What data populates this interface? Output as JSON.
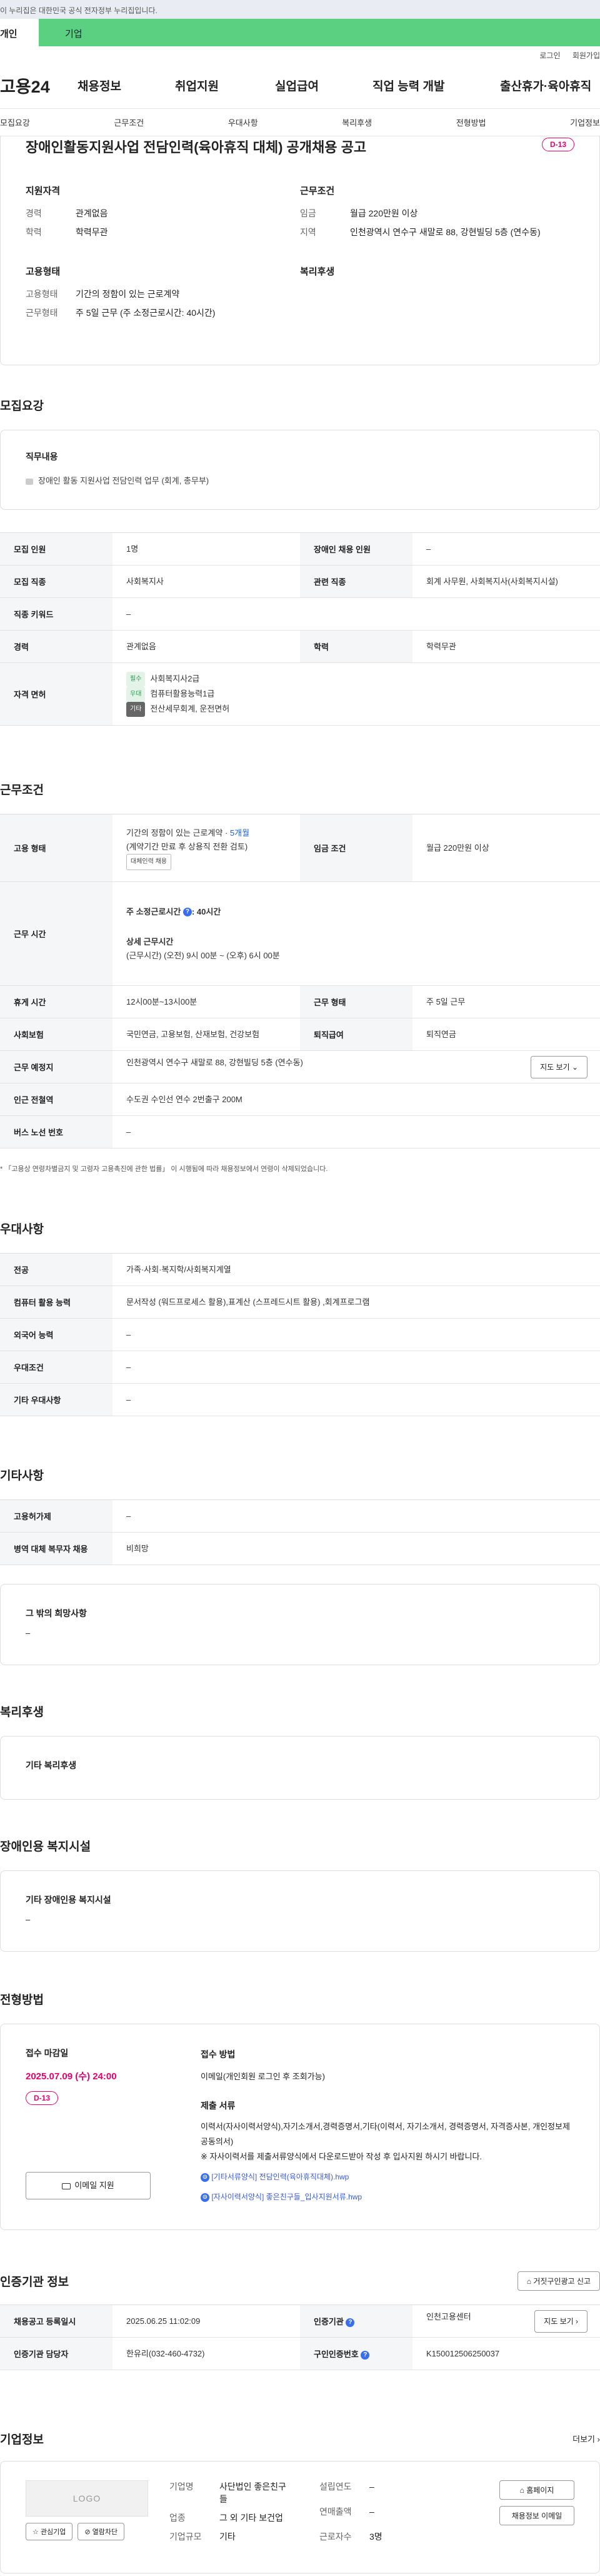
{
  "gov_strip": "이 누리집은 대한민국 공식 전자정부 누리집입니다.",
  "member_tabs": [
    "개인",
    "기업"
  ],
  "util_links": [
    "로그인",
    "회원가입"
  ],
  "logo": "고용24",
  "gnb_menu": [
    "채용정보",
    "취업지원",
    "실업급여",
    "직업 능력 개발",
    "출산휴가·육아휴직"
  ],
  "subnav": [
    "모집요강",
    "근무조건",
    "우대사항",
    "복리후생",
    "전형방법",
    "기업정보"
  ],
  "job": {
    "title": "장애인활동지원사업 전담인력(육아휴직 대체) 공개채용 공고",
    "dday": "D-13",
    "qual_h": "지원자격",
    "cond_h": "근무조건",
    "emp_h": "고용형태",
    "welfare_h": "복리후생",
    "career_k": "경력",
    "career_v": "관계없음",
    "edu_k": "학력",
    "edu_v": "학력무관",
    "wage_k": "임금",
    "wage_v": "월급 220만원 이상",
    "region_k": "지역",
    "region_v": "인천광역시 연수구 새말로 88, 강현빌딩 5층 (연수동)",
    "emptype_k": "고용형태",
    "emptype_v": "기간의 정함이 있는 근로계약",
    "worktype_k": "근무형태",
    "worktype_v": "주 5일 근무 (주 소정근로시간: 40시간)"
  },
  "recruit": {
    "title": "모집요강",
    "duty_h": "직무내용",
    "duty_v": "장애인 활동 지원사업 전담인력 업무 (회계, 총무부)",
    "rows": {
      "count_k": "모집 인원",
      "count_v": "1명",
      "disab_k": "장애인 채용 인원",
      "disab_v": "–",
      "job_k": "모집 직종",
      "job_v": "사회복지사",
      "rel_k": "관련 직종",
      "rel_v": "회계 사무원, 사회복지사(사회복지시설)",
      "kw_k": "직종 키워드",
      "kw_v": "–",
      "career_k": "경력",
      "career_v": "관계없음",
      "edu_k": "학력",
      "edu_v": "학력무관",
      "lic_k": "자격 면허",
      "lic_tags": [
        "필수",
        "우대",
        "기타"
      ],
      "lic_vals": [
        "사회복지사2급",
        "컴퓨터활용능력1급",
        "전산세무회계, 운전면허"
      ]
    }
  },
  "cond": {
    "title": "근무조건",
    "emp_k": "고용 형태",
    "emp_v1": "기간의 정함이 있는 근로계약 · ",
    "emp_v1b": "5개월",
    "emp_v2": "(계약기간 만료 후 상용직 전환 검토)",
    "emp_tag": "대체인력 채용",
    "wage_k": "임금 조건",
    "wage_v": "월급 220만원 이상",
    "time_k": "근무 시간",
    "time_v1": "주 소정근로시간",
    "time_v1b": ": 40시간",
    "time_v2": "상세 근무시간",
    "time_v3": "(근무시간) (오전) 9시 00분 ~ (오후) 6시 00분",
    "rest_k": "휴게 시간",
    "rest_v": "12시00분~13시00분",
    "form_k": "근무 형태",
    "form_v": "주 5일 근무",
    "ins_k": "사회보험",
    "ins_v": "국민연금, 고용보험, 산재보험, 건강보험",
    "sev_k": "퇴직급여",
    "sev_v": "퇴직연금",
    "place_k": "근무 예정지",
    "place_v": "인천광역시 연수구 새말로 88, 강현빌딩 5층 (연수동)",
    "map_btn": "지도 보기",
    "subway_k": "인근 전철역",
    "subway_v": "수도권 수인선 연수 2번출구 200M",
    "bus_k": "버스 노선 번호",
    "bus_v": "–",
    "note": "* 「고용상 연령차별금지 및 고령자 고용촉진에 관한 법률」 이 시행됨에 따라 채용정보에서 연령이 삭제되었습니다."
  },
  "pref": {
    "title": "우대사항",
    "major_k": "전공",
    "major_v": "가족·사회·복지학/사회복지계열",
    "pc_k": "컴퓨터 활용 능력",
    "pc_v": "문서작성 (워드프로세스 활용),표계산 (스프레드시트 활용) ,회계프로그램",
    "lang_k": "외국어 능력",
    "lang_v": "–",
    "cond_k": "우대조건",
    "cond_v": "–",
    "etc_k": "기타 우대사항",
    "etc_v": "–"
  },
  "etc": {
    "title": "기타사항",
    "emp_k": "고용허가제",
    "emp_v": "–",
    "mil_k": "병역 대체 복무자 채용",
    "mil_v": "비희망",
    "hope_h": "그 밖의 희망사항",
    "hope_v": "–"
  },
  "welfare": {
    "title": "복리후생",
    "h": "기타 복리후생"
  },
  "facility": {
    "title": "장애인용 복지시설",
    "h": "기타 장애인용 복지시설",
    "v": "–"
  },
  "method": {
    "title": "전형방법",
    "deadline_h": "접수 마감일",
    "deadline_v": "2025.07.09 (수) 24:00",
    "dday": "D-13",
    "email_btn": "이메일 지원",
    "how_h": "접수 방법",
    "how_v": "이메일(개인회원 로그인 후 조회가능)",
    "docs_h": "제출 서류",
    "docs_v": "이력서(자사이력서양식),자기소개서,경력증명서,기타(이력서, 자기소개서, 경력증명서, 자격증사본, 개인정보제공동의서)",
    "docs_note": "※ 자사이력서를 제출서류양식에서 다운로드받아 작성 후 입사지원 하시기 바랍니다.",
    "file1": "[기타서류양식] 전담인력(육아휴직대체).hwp",
    "file2": "[자사이력서양식] 좋은친구들_입사지원서류.hwp"
  },
  "agency": {
    "title": "인증기관 정보",
    "report_btn": "거짓구인광고 신고",
    "reg_k": "채용공고 등록일시",
    "reg_v": "2025.06.25 11:02:09",
    "org_k": "인증기관",
    "org_v": "인천고용센터",
    "map_btn": "지도 보기",
    "mgr_k": "인증기관 담당자",
    "mgr_v": "한유리(032-460-4732)",
    "no_k": "구인인증번호",
    "no_v": "K150012506250037"
  },
  "company": {
    "title": "기업정보",
    "more": "더보기",
    "logo_text": "LOGO",
    "fav_btn": "관심기업",
    "block_btn": "열람차단",
    "type_k": "기업명",
    "type_v": "사단법인 좋은친구들",
    "ind_k": "업종",
    "ind_v": "그 외 기타 보건업",
    "size_k": "기업규모",
    "size_v": "기타",
    "est_k": "설립연도",
    "est_v": "–",
    "sales_k": "연매출액",
    "sales_v": "–",
    "emp_k": "근로자수",
    "emp_v": "3명",
    "home_btn": "홈페이지",
    "mail_btn": "채용정보 이메일"
  },
  "colors": {
    "green": "#5bd080",
    "accent_red": "#e6006e",
    "link_blue": "#3a5bd8"
  }
}
